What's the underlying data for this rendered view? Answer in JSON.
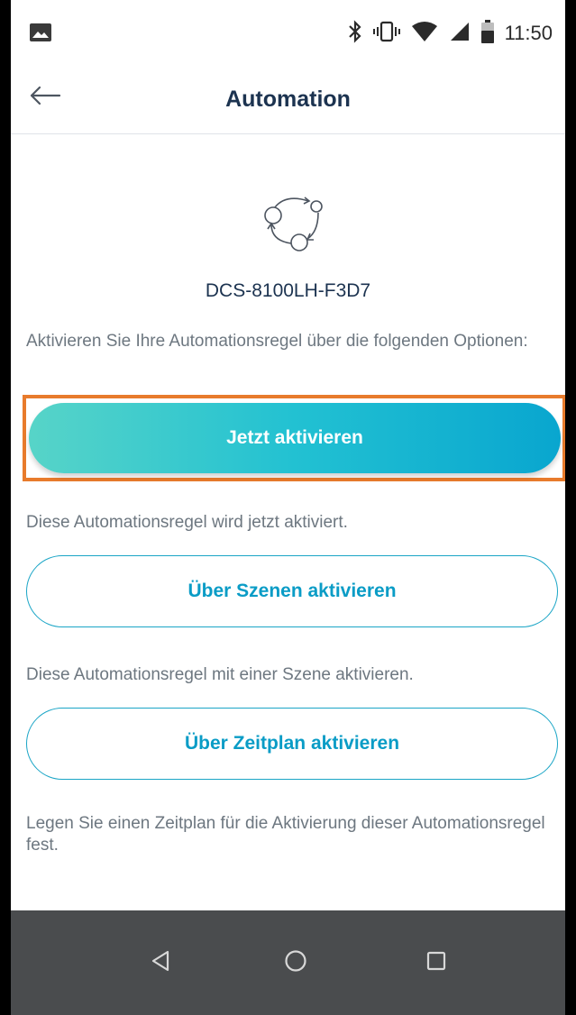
{
  "status_bar": {
    "time": "11:50",
    "left_icon": "image-icon",
    "icons": [
      "bluetooth-icon",
      "vibrate-icon",
      "wifi-icon",
      "signal-icon",
      "battery-icon"
    ]
  },
  "app_bar": {
    "title": "Automation",
    "back_icon": "back-arrow-icon"
  },
  "device": {
    "icon": "automation-cycle-icon",
    "name": "DCS-8100LH-F3D7"
  },
  "intro_text": "Aktivieren Sie Ihre Automationsregel über die folgenden Optionen:",
  "options": [
    {
      "label": "Jetzt aktivieren",
      "description": "Diese Automationsregel wird jetzt aktiviert.",
      "style": "primary",
      "highlighted": true,
      "highlight_color": "#e87b2c"
    },
    {
      "label": "Über Szenen aktivieren",
      "description": "Diese Automationsregel mit einer Szene aktivieren.",
      "style": "outline"
    },
    {
      "label": "Über Zeitplan aktivieren",
      "description": "Legen Sie einen Zeitplan für die Aktivierung dieser Automationsregel fest.",
      "style": "outline"
    }
  ],
  "colors": {
    "title": "#1c3350",
    "accent": "#0a9cc6",
    "gradient_start": "#57d4c8",
    "gradient_end": "#09a6cf",
    "body_text": "#6d7780",
    "nav_bar": "#4a4c4e"
  },
  "nav_bar": {
    "buttons": [
      "back-triangle-icon",
      "home-circle-icon",
      "recents-square-icon"
    ]
  }
}
